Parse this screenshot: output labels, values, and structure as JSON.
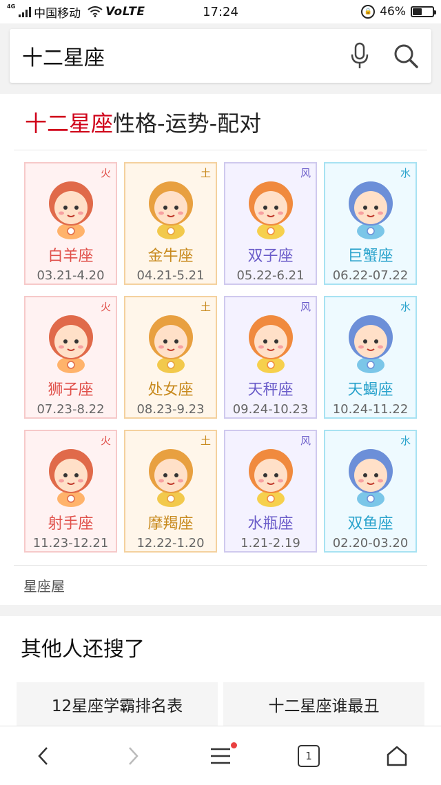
{
  "status_bar": {
    "network_tag": "4G",
    "carrier": "中国移动",
    "volte": "VoLTE",
    "time": "17:24",
    "battery_percent": "46%",
    "battery_level": 0.46
  },
  "search": {
    "query": "十二星座",
    "mic_icon": "mic-icon",
    "search_icon": "search-icon"
  },
  "result": {
    "title_highlight": "十二星座",
    "title_rest": "性格-运势-配对",
    "source": "星座屋",
    "zodiacs": [
      {
        "name": "白羊座",
        "dates": "03.21-4.20",
        "element": "火",
        "kind": "fire",
        "icon": "aries-avatar-icon"
      },
      {
        "name": "金牛座",
        "dates": "04.21-5.21",
        "element": "土",
        "kind": "earth",
        "icon": "taurus-avatar-icon"
      },
      {
        "name": "双子座",
        "dates": "05.22-6.21",
        "element": "风",
        "kind": "wind",
        "icon": "gemini-avatar-icon"
      },
      {
        "name": "巨蟹座",
        "dates": "06.22-07.22",
        "element": "水",
        "kind": "water",
        "icon": "cancer-avatar-icon"
      },
      {
        "name": "狮子座",
        "dates": "07.23-8.22",
        "element": "火",
        "kind": "fire",
        "icon": "leo-avatar-icon"
      },
      {
        "name": "处女座",
        "dates": "08.23-9.23",
        "element": "土",
        "kind": "earth",
        "icon": "virgo-avatar-icon"
      },
      {
        "name": "天秤座",
        "dates": "09.24-10.23",
        "element": "风",
        "kind": "wind",
        "icon": "libra-avatar-icon"
      },
      {
        "name": "天蝎座",
        "dates": "10.24-11.22",
        "element": "水",
        "kind": "water",
        "icon": "scorpio-avatar-icon"
      },
      {
        "name": "射手座",
        "dates": "11.23-12.21",
        "element": "火",
        "kind": "fire",
        "icon": "sagittarius-avatar-icon"
      },
      {
        "name": "摩羯座",
        "dates": "12.22-1.20",
        "element": "土",
        "kind": "earth",
        "icon": "capricorn-avatar-icon"
      },
      {
        "name": "水瓶座",
        "dates": "1.21-2.19",
        "element": "风",
        "kind": "wind",
        "icon": "aquarius-avatar-icon"
      },
      {
        "name": "双鱼座",
        "dates": "02.20-03.20",
        "element": "水",
        "kind": "water",
        "icon": "pisces-avatar-icon"
      }
    ]
  },
  "others": {
    "title": "其他人还搜了",
    "items": [
      "12星座学霸排名表",
      "十二星座谁最丑"
    ]
  },
  "bottom_nav": {
    "tab_count": "1",
    "icons": [
      "back-icon",
      "forward-icon",
      "menu-icon",
      "tabs-icon",
      "home-icon"
    ]
  },
  "colors": {
    "highlight": "#d0021b",
    "fire": "#e0504a",
    "earth": "#c88a1e",
    "wind": "#6a5cc9",
    "water": "#2aa3cc"
  }
}
